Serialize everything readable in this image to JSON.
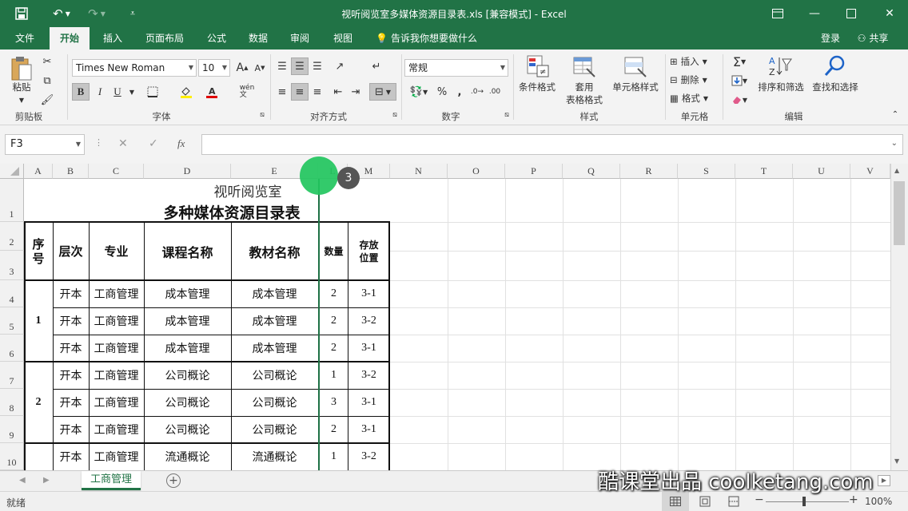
{
  "window": {
    "title": "视听阅览室多媒体资源目录表.xls  [兼容模式] - Excel",
    "accent": "#217346"
  },
  "tabs": [
    "文件",
    "开始",
    "插入",
    "页面布局",
    "公式",
    "数据",
    "审阅",
    "视图"
  ],
  "tell_me": "告诉我你想要做什么",
  "login": "登录",
  "share": "共享",
  "ribbon": {
    "clipboard": {
      "paste": "粘贴",
      "label": "剪贴板"
    },
    "font": {
      "name": "Times New Roman",
      "size": "10",
      "label": "字体",
      "bold": "B",
      "italic": "I",
      "underline": "U",
      "wen": "wén\n文"
    },
    "alignment": {
      "label": "对齐方式"
    },
    "number": {
      "format": "常规",
      "label": "数字",
      "percent": "%",
      "comma": ","
    },
    "styles": {
      "cond": "条件格式",
      "table1": "套用",
      "table2": "表格格式",
      "cell": "单元格样式",
      "label": "样式"
    },
    "cells": {
      "insert": "插入",
      "delete": "删除",
      "format": "格式",
      "label": "单元格"
    },
    "editing": {
      "sort": "排序和筛选",
      "find": "查找和选择",
      "label": "编辑"
    }
  },
  "formula_bar": {
    "name_box": "F3",
    "fx": "fx",
    "value": ""
  },
  "columns": [
    "A",
    "B",
    "C",
    "D",
    "E",
    "L",
    "M",
    "N",
    "O",
    "P",
    "Q",
    "R",
    "S",
    "T",
    "U",
    "V"
  ],
  "rows": [
    "1",
    "2",
    "3",
    "4",
    "5",
    "6",
    "7",
    "8",
    "9",
    "10"
  ],
  "sheet": {
    "title1": "视听阅览室",
    "title2": "多种媒体资源目录表",
    "headers": {
      "seq": "序\n号",
      "level": "层次",
      "major": "专业",
      "course": "课程名称",
      "book": "教材名称",
      "qty": "数量",
      "loc": "存放\n位置"
    },
    "groups": [
      "1",
      "2"
    ],
    "data": [
      [
        "开本",
        "工商管理",
        "成本管理",
        "成本管理",
        "2",
        "3-1"
      ],
      [
        "开本",
        "工商管理",
        "成本管理",
        "成本管理",
        "2",
        "3-2"
      ],
      [
        "开本",
        "工商管理",
        "成本管理",
        "成本管理",
        "2",
        "3-1"
      ],
      [
        "开本",
        "工商管理",
        "公司概论",
        "公司概论",
        "1",
        "3-2"
      ],
      [
        "开本",
        "工商管理",
        "公司概论",
        "公司概论",
        "3",
        "3-1"
      ],
      [
        "开本",
        "工商管理",
        "公司概论",
        "公司概论",
        "2",
        "3-1"
      ],
      [
        "开本",
        "工商管理",
        "流通概论",
        "流通概论",
        "1",
        "3-2"
      ]
    ]
  },
  "sheet_tab": "工商管理",
  "status": {
    "ready": "就绪",
    "zoom": "100%"
  },
  "tutorial": {
    "step": "3",
    "watermark": "酷课堂出品 coolketang.com"
  }
}
